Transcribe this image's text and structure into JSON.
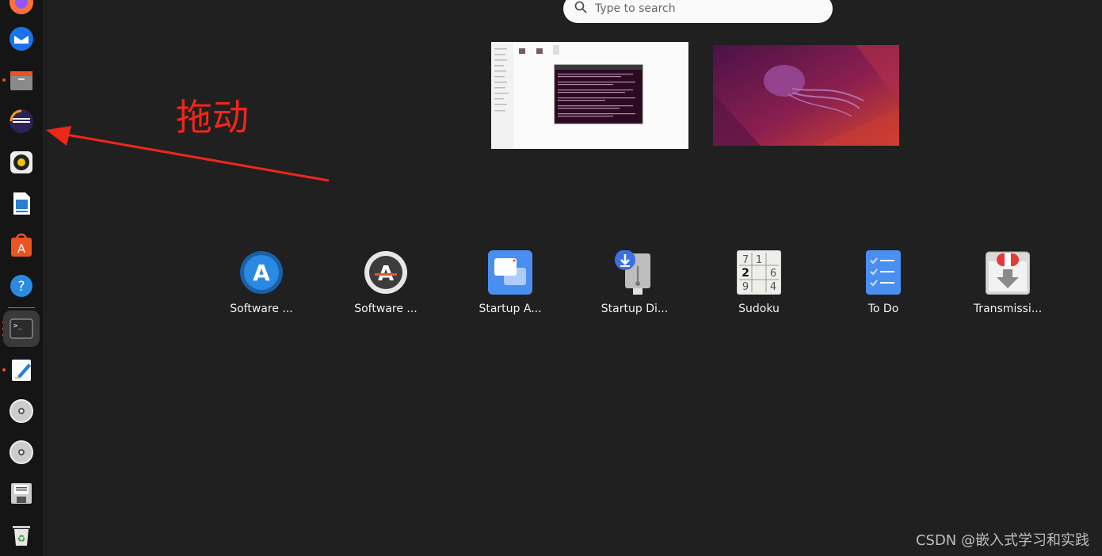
{
  "search": {
    "placeholder": "Type to search"
  },
  "dock": {
    "items": [
      {
        "icon": "firefox-icon"
      },
      {
        "icon": "thunderbird-icon"
      },
      {
        "icon": "files-icon",
        "running": true
      },
      {
        "icon": "eclipse-icon"
      },
      {
        "icon": "rhythmbox-icon"
      },
      {
        "icon": "libreoffice-writer-icon"
      },
      {
        "icon": "ubuntu-software-icon"
      },
      {
        "icon": "help-icon"
      },
      {
        "icon": "terminal-icon",
        "running": true,
        "active": true
      },
      {
        "icon": "text-editor-icon",
        "running": true
      },
      {
        "icon": "disc-icon"
      },
      {
        "icon": "disc-icon"
      },
      {
        "icon": "floppy-icon"
      },
      {
        "icon": "trash-icon"
      }
    ]
  },
  "apps": [
    {
      "label": "Software ...",
      "icon": "software-icon"
    },
    {
      "label": "Software ...",
      "icon": "software-updater-icon"
    },
    {
      "label": "Startup A...",
      "icon": "startup-applications-icon"
    },
    {
      "label": "Startup Di...",
      "icon": "startup-disk-icon"
    },
    {
      "label": "Sudoku",
      "icon": "sudoku-icon"
    },
    {
      "label": "To Do",
      "icon": "todo-icon"
    },
    {
      "label": "Transmissi...",
      "icon": "transmission-icon"
    }
  ],
  "sudoku_digits": [
    "7",
    "1",
    "2",
    "6",
    "9",
    "4"
  ],
  "annotation": {
    "text": "拖动"
  },
  "watermark": {
    "text": "CSDN @嵌入式学习和实践"
  },
  "colors": {
    "accent": "#e95420",
    "annotation": "#f0261b",
    "background": "#202020"
  }
}
